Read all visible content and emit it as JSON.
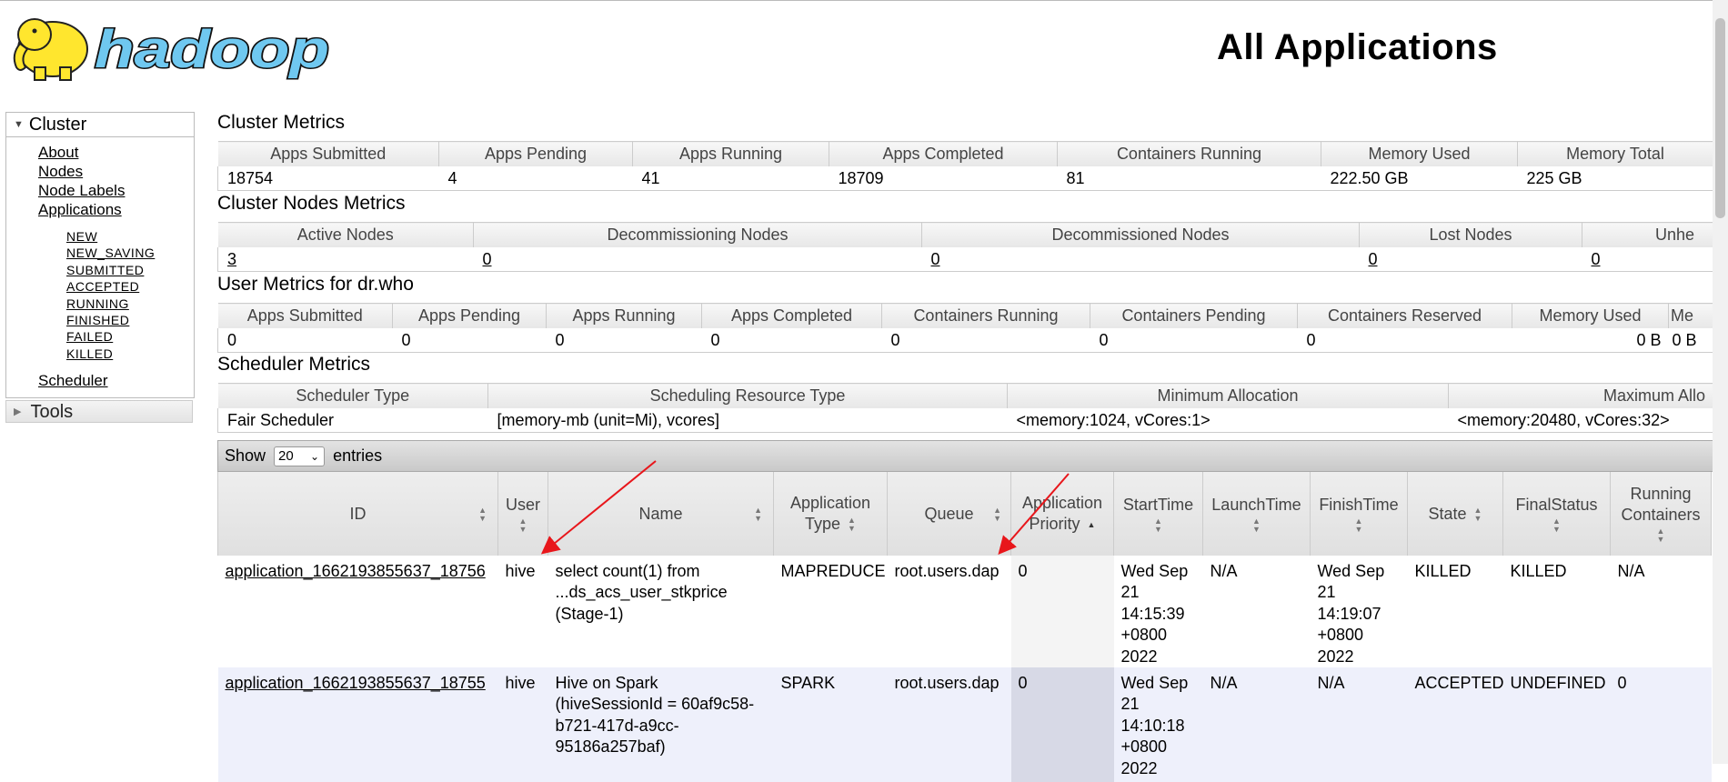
{
  "header": {
    "logo_text": "hadoop",
    "page_title": "All Applications"
  },
  "sidebar": {
    "cluster_label": "Cluster",
    "cluster_links": [
      "About",
      "Nodes",
      "Node Labels",
      "Applications"
    ],
    "app_states": [
      "NEW",
      "NEW_SAVING",
      "SUBMITTED",
      "ACCEPTED",
      "RUNNING",
      "FINISHED",
      "FAILED",
      "KILLED"
    ],
    "scheduler_link": "Scheduler",
    "tools_label": "Tools"
  },
  "cluster_metrics": {
    "title": "Cluster Metrics",
    "headers": [
      "Apps Submitted",
      "Apps Pending",
      "Apps Running",
      "Apps Completed",
      "Containers Running",
      "Memory Used",
      "Memory Total"
    ],
    "values": [
      "18754",
      "4",
      "41",
      "18709",
      "81",
      "222.50 GB",
      "225 GB"
    ]
  },
  "node_metrics": {
    "title": "Cluster Nodes Metrics",
    "headers": [
      "Active Nodes",
      "Decommissioning Nodes",
      "Decommissioned Nodes",
      "Lost Nodes",
      "Unhe"
    ],
    "values": [
      "3",
      "0",
      "0",
      "0",
      "0"
    ]
  },
  "user_metrics": {
    "title": "User Metrics for dr.who",
    "headers": [
      "Apps Submitted",
      "Apps Pending",
      "Apps Running",
      "Apps Completed",
      "Containers Running",
      "Containers Pending",
      "Containers Reserved",
      "Memory Used",
      "Me"
    ],
    "values": [
      "0",
      "0",
      "0",
      "0",
      "0",
      "0",
      "0",
      "0 B",
      "0 B"
    ]
  },
  "scheduler_metrics": {
    "title": "Scheduler Metrics",
    "headers": [
      "Scheduler Type",
      "Scheduling Resource Type",
      "Minimum Allocation",
      "Maximum Allo"
    ],
    "values": [
      "Fair Scheduler",
      "[memory-mb (unit=Mi), vcores]",
      "<memory:1024, vCores:1>",
      "<memory:20480, vCores:32>"
    ]
  },
  "table_controls": {
    "show_label": "Show",
    "page_size": "20",
    "entries_label": "entries"
  },
  "apps_table": {
    "headers": [
      "ID",
      "User",
      "Name",
      "Application Type",
      "Queue",
      "Application Priority",
      "StartTime",
      "LaunchTime",
      "FinishTime",
      "State",
      "FinalStatus",
      "Running Containers"
    ],
    "rows": [
      {
        "id": "application_1662193855637_18756",
        "user": "hive",
        "name": "select count(1) from ...ds_acs_user_stkprice (Stage-1)",
        "type": "MAPREDUCE",
        "queue": "root.users.dap",
        "priority": "0",
        "start": "Wed Sep 21 14:15:39 +0800 2022",
        "launch": "N/A",
        "finish": "Wed Sep 21 14:19:07 +0800 2022",
        "state": "KILLED",
        "final": "KILLED",
        "running": "N/A"
      },
      {
        "id": "application_1662193855637_18755",
        "user": "hive",
        "name": "Hive on Spark (hiveSessionId = 60af9c58-b721-417d-a9cc-95186a257baf)",
        "type": "SPARK",
        "queue": "root.users.dap",
        "priority": "0",
        "start": "Wed Sep 21 14:10:18 +0800 2022",
        "launch": "N/A",
        "finish": "N/A",
        "state": "ACCEPTED",
        "final": "UNDEFINED",
        "running": "0"
      }
    ]
  },
  "colors": {
    "annotation_arrow": "#e8161b",
    "logo_yellow": "#ffe62e",
    "logo_blue": "#6fc8f0"
  }
}
